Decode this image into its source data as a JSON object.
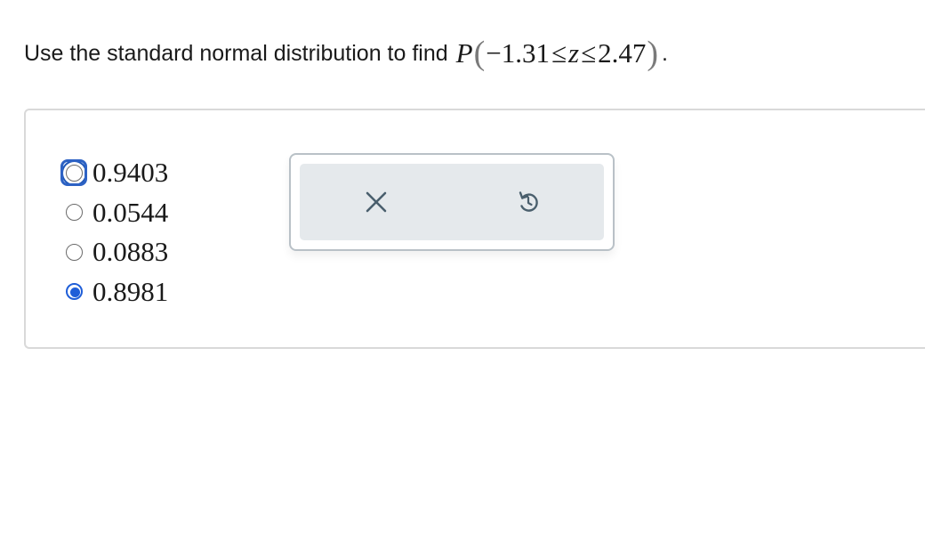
{
  "question": {
    "text": "Use the standard normal distribution to find",
    "math": {
      "func": "P",
      "open": "(",
      "lower": "−1.31",
      "le1": "≤",
      "var": "z",
      "le2": "≤",
      "upper": "2.47",
      "close": ")"
    },
    "period": "."
  },
  "options": [
    {
      "label": "0.9403",
      "selected": false,
      "focused": true
    },
    {
      "label": "0.0544",
      "selected": false,
      "focused": false
    },
    {
      "label": "0.0883",
      "selected": false,
      "focused": false
    },
    {
      "label": "0.8981",
      "selected": true,
      "focused": false
    }
  ],
  "tools": {
    "clear_icon": "close-icon",
    "reset_icon": "undo-icon"
  },
  "colors": {
    "accent": "#1f5ed8",
    "focus_ring": "#2d62c4",
    "tool_bg": "#e5e9ec",
    "icon": "#4a5f6d"
  }
}
